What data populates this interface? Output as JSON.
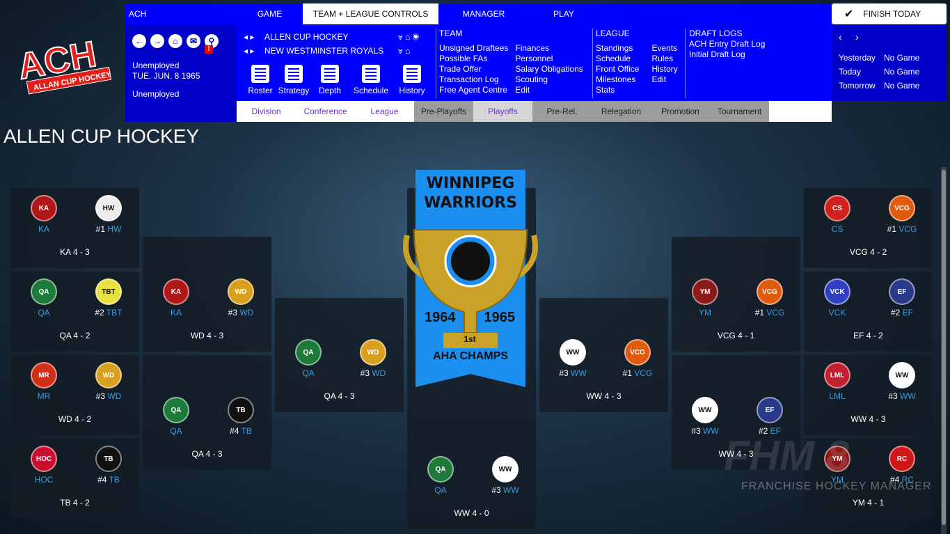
{
  "logo": {
    "text": "ACH",
    "subtext": "ALLAN CUP HOCKEY"
  },
  "topbar": {
    "league": "ACH",
    "tabs": [
      "GAME",
      "TEAM + LEAGUE CONTROLS",
      "MANAGER",
      "PLAY"
    ],
    "active": 1,
    "finish": "FINISH TODAY"
  },
  "status": {
    "line1": "Unemployed",
    "date": "TUE. JUN. 8 1965",
    "line3": "Unemployed",
    "mail_badge": "!"
  },
  "selectors": {
    "league": "ALLEN CUP HOCKEY",
    "team": "NEW WESTMINSTER ROYALS"
  },
  "toolbar": [
    "Roster",
    "Strategy",
    "Depth",
    "Schedule",
    "History"
  ],
  "team_menu": {
    "header": "TEAM",
    "col1": [
      "Unsigned Draftees",
      "Possible FAs",
      "Trade Offer",
      "Transaction Log",
      "Free Agent Centre"
    ],
    "col2": [
      "Finances",
      "Personnel",
      "Salary Obligations",
      "Scouting",
      "Edit"
    ]
  },
  "league_menu": {
    "header": "LEAGUE",
    "col1": [
      "Standings",
      "Schedule",
      "Front Office",
      "Milestones",
      "Stats"
    ],
    "col2": [
      "Events",
      "Rules",
      "History",
      "Edit"
    ]
  },
  "draft_menu": {
    "header": "DRAFT LOGS",
    "items": [
      "ACH Entry Draft Log",
      "Initial Draft Log"
    ]
  },
  "days": [
    {
      "label": "Yesterday",
      "value": "No Game"
    },
    {
      "label": "Today",
      "value": "No Game"
    },
    {
      "label": "Tomorrow",
      "value": "No Game"
    }
  ],
  "subtabs": [
    {
      "label": "Division",
      "style": "w"
    },
    {
      "label": "Conference",
      "style": "w"
    },
    {
      "label": "League",
      "style": "w"
    },
    {
      "label": "Pre-Playoffs",
      "style": "g"
    },
    {
      "label": "Playoffs",
      "style": "sel"
    },
    {
      "label": "Pre-Rel.",
      "style": "g"
    },
    {
      "label": "Relegation",
      "style": "g"
    },
    {
      "label": "Promotion",
      "style": "g"
    },
    {
      "label": "Tournament",
      "style": "g"
    }
  ],
  "page_title": "ALLEN CUP HOCKEY",
  "champion": {
    "line1": "WINNIPEG",
    "line2": "WARRIORS",
    "years": [
      "1964",
      "1965"
    ],
    "place": "1st",
    "title": "AHA CHAMPS"
  },
  "colors": {
    "nav": "#0000ff",
    "nav_dark": "#0000c8",
    "team_abbr": "#3c9be0",
    "banner": "#1a8ff0"
  },
  "series": [
    {
      "a": {
        "seed": "",
        "abbr": "KA"
      },
      "b": {
        "seed": "#1",
        "abbr": "HW"
      },
      "result": "KA 4 - 3"
    },
    {
      "a": {
        "seed": "",
        "abbr": "QA"
      },
      "b": {
        "seed": "#2",
        "abbr": "TBT"
      },
      "result": "QA 4 - 2"
    },
    {
      "a": {
        "seed": "",
        "abbr": "MR"
      },
      "b": {
        "seed": "#3",
        "abbr": "WD"
      },
      "result": "WD 4 - 2"
    },
    {
      "a": {
        "seed": "",
        "abbr": "HOC"
      },
      "b": {
        "seed": "#4",
        "abbr": "TB"
      },
      "result": "TB 4 - 2"
    },
    {
      "a": {
        "seed": "",
        "abbr": "KA"
      },
      "b": {
        "seed": "#3",
        "abbr": "WD"
      },
      "result": "WD 4 - 3"
    },
    {
      "a": {
        "seed": "",
        "abbr": "QA"
      },
      "b": {
        "seed": "#4",
        "abbr": "TB"
      },
      "result": "QA 4 - 3"
    },
    {
      "a": {
        "seed": "",
        "abbr": "QA"
      },
      "b": {
        "seed": "#3",
        "abbr": "WD"
      },
      "result": "QA 4 - 3"
    },
    {
      "a": {
        "seed": "",
        "abbr": "QA"
      },
      "b": {
        "seed": "#3",
        "abbr": "WW"
      },
      "result": "WW 4 - 0"
    },
    {
      "a": {
        "seed": "#3",
        "abbr": "WW"
      },
      "b": {
        "seed": "#1",
        "abbr": "VCG"
      },
      "result": "WW 4 - 3"
    },
    {
      "a": {
        "seed": "",
        "abbr": "YM"
      },
      "b": {
        "seed": "#1",
        "abbr": "VCG"
      },
      "result": "VCG 4 - 1"
    },
    {
      "a": {
        "seed": "#3",
        "abbr": "WW"
      },
      "b": {
        "seed": "#2",
        "abbr": "EF"
      },
      "result": "WW 4 - 3"
    },
    {
      "a": {
        "seed": "",
        "abbr": "CS"
      },
      "b": {
        "seed": "#1",
        "abbr": "VCG"
      },
      "result": "VCG 4 - 2"
    },
    {
      "a": {
        "seed": "",
        "abbr": "VCK"
      },
      "b": {
        "seed": "#2",
        "abbr": "EF"
      },
      "result": "EF 4 - 2"
    },
    {
      "a": {
        "seed": "",
        "abbr": "LML"
      },
      "b": {
        "seed": "#3",
        "abbr": "WW"
      },
      "result": "WW 4 - 3"
    },
    {
      "a": {
        "seed": "",
        "abbr": "YM"
      },
      "b": {
        "seed": "#4",
        "abbr": "RC"
      },
      "result": "YM 4 - 1"
    }
  ],
  "watermark": {
    "brand": "FHM 8",
    "tagline": "FRANCHISE HOCKEY MANAGER"
  }
}
